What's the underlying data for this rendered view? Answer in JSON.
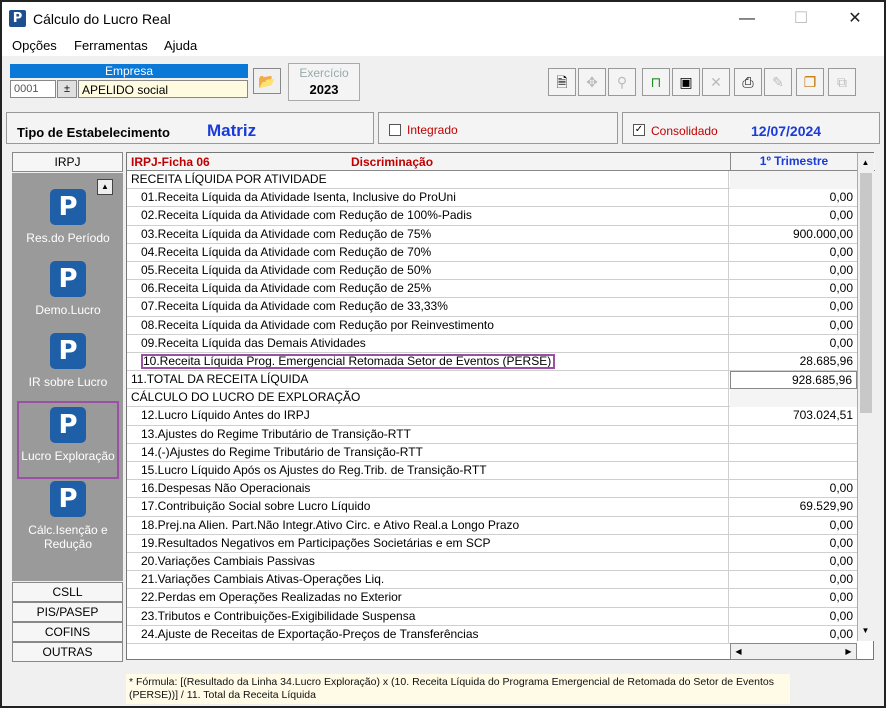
{
  "window": {
    "title": "Cálculo do Lucro Real",
    "icon": "app-p-icon"
  },
  "window_controls": {
    "minimize": "—",
    "maximize": "☐",
    "close": "✕"
  },
  "menu": [
    "Opções",
    "Ferramentas",
    "Ajuda"
  ],
  "empresa": {
    "label": "Empresa",
    "code": "0001",
    "spin": "±",
    "name": "APELIDO social"
  },
  "exercicio": {
    "label": "Exercício",
    "value": "2023"
  },
  "toolbar_icons": [
    "document-icon",
    "navigate-icon",
    "search-icon",
    "lock-icon",
    "save-icon",
    "delete-icon",
    "print-icon",
    "edit-icon",
    "copy-icon",
    "export-icon"
  ],
  "tipo": {
    "label": "Tipo de Estabelecimento",
    "value": "Matriz",
    "integrado": "Integrado",
    "consolidado": "Consolidado",
    "date": "12/07/2024"
  },
  "left_tabs": {
    "irpj": "IRPJ",
    "csll": "CSLL",
    "pis": "PIS/PASEP",
    "cofins": "COFINS",
    "outras": "OUTRAS"
  },
  "left_items": [
    {
      "label": "Res.do Período"
    },
    {
      "label": "Demo.Lucro"
    },
    {
      "label": "IR sobre Lucro"
    },
    {
      "label": "Lucro Exploração"
    },
    {
      "label": "Cálc.Isenção e Redução"
    }
  ],
  "grid": {
    "ficha": "IRPJ-Ficha 06",
    "discriminacao": "Discriminação",
    "period": "1º Trimestre",
    "rows": [
      {
        "label": "RECEITA LÍQUIDA POR ATIVIDADE",
        "value": "",
        "indent": false,
        "section": true
      },
      {
        "label": "01.Receita Líquida da Atividade Isenta, Inclusive do ProUni",
        "value": "0,00",
        "indent": true
      },
      {
        "label": "02.Receita Líquida da Atividade com Redução de 100%-Padis",
        "value": "0,00",
        "indent": true
      },
      {
        "label": "03.Receita Líquida da Atividade com Redução de 75%",
        "value": "900.000,00",
        "indent": true
      },
      {
        "label": "04.Receita Líquida da Atividade com Redução de 70%",
        "value": "0,00",
        "indent": true
      },
      {
        "label": "05.Receita Líquida da Atividade com Redução de 50%",
        "value": "0,00",
        "indent": true
      },
      {
        "label": "06.Receita Líquida da Atividade com Redução de 25%",
        "value": "0,00",
        "indent": true
      },
      {
        "label": "07.Receita Líquida da Atividade com Redução de 33,33%",
        "value": "0,00",
        "indent": true
      },
      {
        "label": "08.Receita Líquida da Atividade com Redução por Reinvestimento",
        "value": "0,00",
        "indent": true
      },
      {
        "label": "09.Receita Líquida das Demais Atividades",
        "value": "0,00",
        "indent": true
      },
      {
        "label": "10.Receita Líquida Prog. Emergencial Retomada Setor de Eventos (PERSE)",
        "value": "28.685,96",
        "indent": true,
        "highlight": true
      },
      {
        "label": "11.TOTAL DA RECEITA LÍQUIDA",
        "value": "928.685,96",
        "indent": false,
        "white": true
      },
      {
        "label": "CÁLCULO DO LUCRO DE EXPLORAÇÃO",
        "value": "",
        "indent": false,
        "section": true
      },
      {
        "label": "12.Lucro Líquido Antes do IRPJ",
        "value": "703.024,51",
        "indent": true
      },
      {
        "label": "13.Ajustes do Regime Tributário de Transição-RTT",
        "value": "",
        "indent": true
      },
      {
        "label": "14.(-)Ajustes do Regime Tributário de Transição-RTT",
        "value": "",
        "indent": true
      },
      {
        "label": "15.Lucro Líquido Após os Ajustes do Reg.Trib. de Transição-RTT",
        "value": "",
        "indent": true
      },
      {
        "label": "16.Despesas Não Operacionais",
        "value": "0,00",
        "indent": true
      },
      {
        "label": "17.Contribuição Social sobre Lucro Líquido",
        "value": "69.529,90",
        "indent": true
      },
      {
        "label": "18.Prej.na Alien. Part.Não Integr.Ativo Circ. e Ativo Real.a Longo Prazo",
        "value": "0,00",
        "indent": true
      },
      {
        "label": "19.Resultados Negativos em Participações Societárias e em SCP",
        "value": "0,00",
        "indent": true
      },
      {
        "label": "20.Variações Cambiais Passivas",
        "value": "0,00",
        "indent": true
      },
      {
        "label": "21.Variações Cambiais Ativas-Operações Liq.",
        "value": "0,00",
        "indent": true
      },
      {
        "label": "22.Perdas em Operações Realizadas no Exterior",
        "value": "0,00",
        "indent": true
      },
      {
        "label": "23.Tributos e Contribuições-Exigibilidade Suspensa",
        "value": "0,00",
        "indent": true
      },
      {
        "label": "24.Ajuste de Receitas de Exportação-Preços de Transferências",
        "value": "0,00",
        "indent": true
      }
    ]
  },
  "formula": "* Fórmula: [(Resultado da Linha 34.Lucro Exploração) x (10. Receita Líquida do Programa Emergencial de Retomada do Setor de Eventos (PERSE))] / 11. Total da Receita Líquida"
}
